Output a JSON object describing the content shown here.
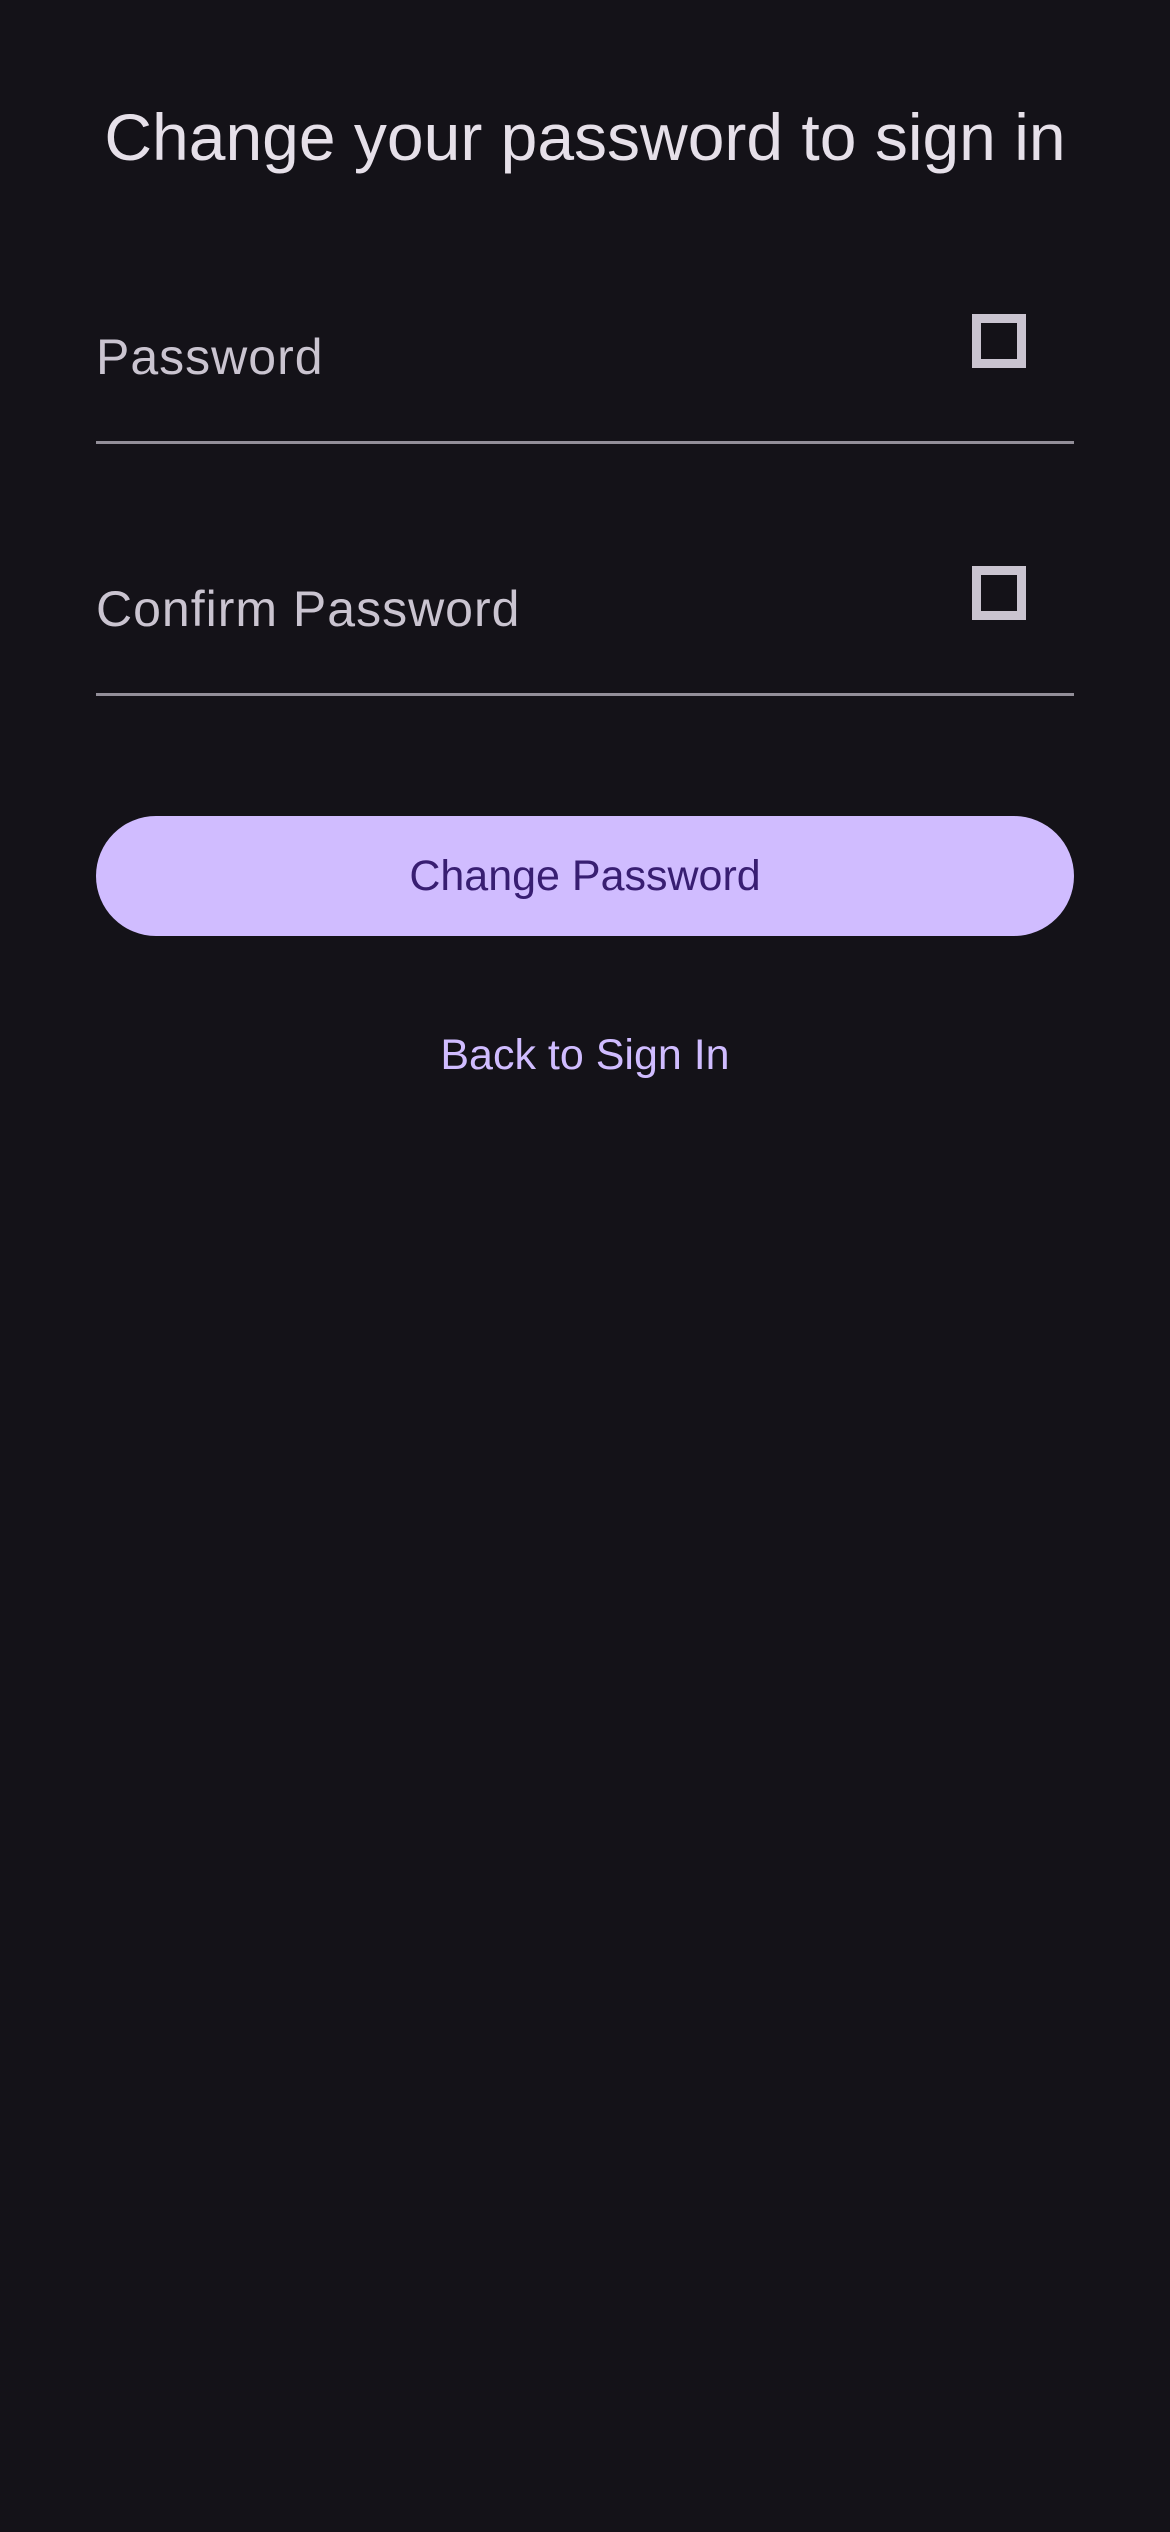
{
  "page": {
    "title": "Change your password to sign in"
  },
  "form": {
    "password": {
      "label": "Password",
      "value": "",
      "toggle_icon": "visibility-toggle-icon"
    },
    "confirm_password": {
      "label": "Confirm Password",
      "value": "",
      "toggle_icon": "visibility-toggle-icon"
    },
    "submit_label": "Change Password",
    "back_link_label": "Back to Sign In"
  },
  "colors": {
    "background": "#141218",
    "primary": "#d0bcff",
    "on_primary": "#381e72",
    "text": "#e6e0e9",
    "label": "#cac4d0",
    "divider": "#938f99"
  }
}
